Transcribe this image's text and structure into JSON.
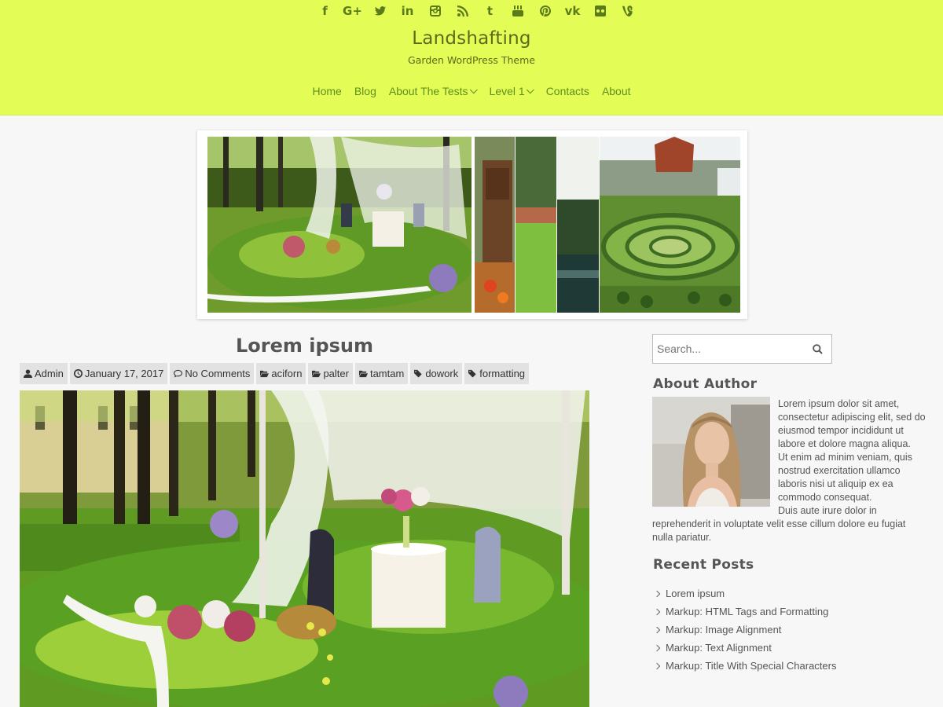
{
  "header": {
    "site_title": "Landshafting",
    "site_description": "Garden WordPress Theme",
    "social_icons": [
      "facebook-icon",
      "google-plus-icon",
      "twitter-icon",
      "linkedin-icon",
      "instagram-icon",
      "rss-icon",
      "tumblr-icon",
      "youtube-icon",
      "pinterest-icon",
      "vk-icon",
      "flickr-icon",
      "vine-icon"
    ],
    "social_glyphs": {
      "facebook": "f",
      "google_plus": "G+",
      "tumblr": "t",
      "vk": "vk",
      "linkedin": "in"
    },
    "nav": [
      {
        "label": "Home"
      },
      {
        "label": "Blog"
      },
      {
        "label": "About The Tests",
        "has_dropdown": true
      },
      {
        "label": "Level 1",
        "has_dropdown": true
      },
      {
        "label": "Contacts"
      },
      {
        "label": "About"
      }
    ],
    "background_color": "#e4fc56",
    "link_color": "#5f8f1c"
  },
  "post": {
    "title": "Lorem ipsum",
    "meta": {
      "author": "Admin",
      "date": "January 17, 2017",
      "comments": "No Comments",
      "categories": [
        "aciforn",
        "palter",
        "tamtam"
      ],
      "tags": [
        "dowork",
        "formatting"
      ]
    }
  },
  "sidebar": {
    "search_placeholder": "Search...",
    "about_author_title": "About Author",
    "about_author_paragraphs": [
      "Lorem ipsum dolor sit amet, consectetur adipiscing elit, sed do eiusmod tempor incididunt ut labore et dolore magna aliqua.",
      "Ut enim ad minim veniam, quis nostrud exercitation ullamco laboris nisi ut aliquip ex ea commodo consequat.",
      "Duis aute irure dolor in reprehenderit in voluptate velit esse cillum dolore eu fugiat nulla pariatur."
    ],
    "recent_posts_title": "Recent Posts",
    "recent_posts": [
      "Lorem ipsum",
      "Markup: HTML Tags and Formatting",
      "Markup: Image Alignment",
      "Markup: Text Alignment",
      "Markup: Title With Special Characters"
    ]
  }
}
